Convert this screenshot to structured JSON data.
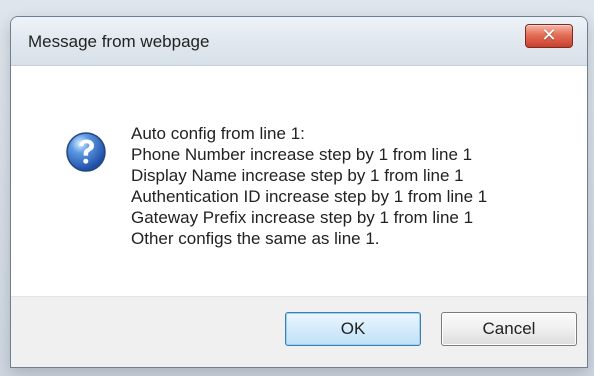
{
  "window": {
    "title": "Message from webpage",
    "close_icon": "close-icon"
  },
  "message": {
    "icon": "question-icon",
    "text": "Auto config from line 1:\nPhone Number increase step by 1 from line 1\nDisplay Name increase step by 1 from line 1\nAuthentication ID increase step by 1 from line 1\nGateway Prefix increase step by 1 from line 1\nOther configs the same as line 1."
  },
  "buttons": {
    "ok": "OK",
    "cancel": "Cancel"
  },
  "colors": {
    "accent": "#2d67c7",
    "close": "#d9533d"
  }
}
